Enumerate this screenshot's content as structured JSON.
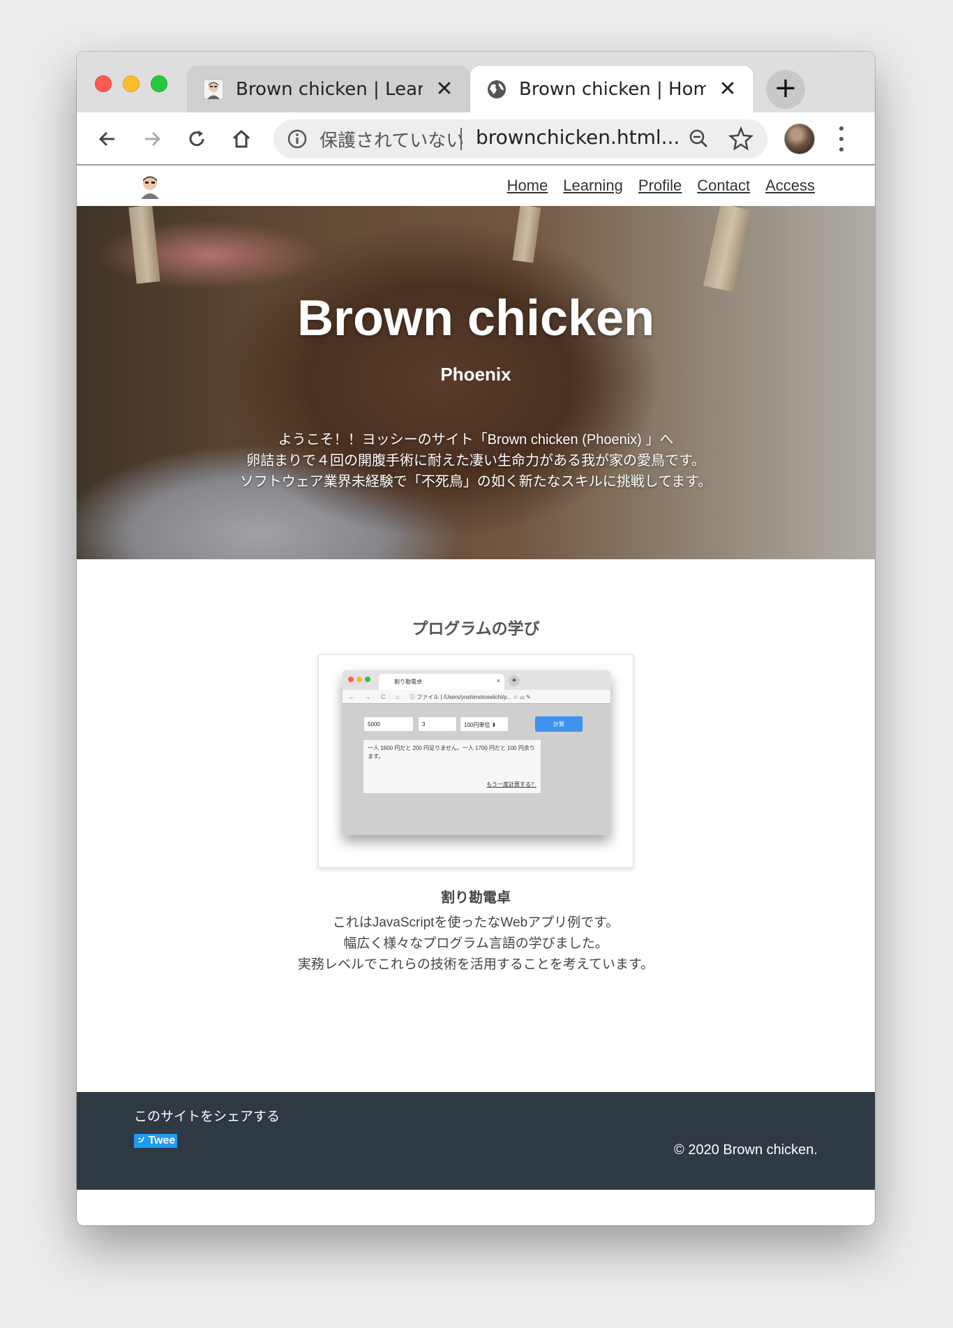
{
  "browser": {
    "tabs": [
      {
        "title": "Brown chicken | Learning",
        "close": "✕"
      },
      {
        "title": "Brown chicken | Home",
        "close": "✕"
      }
    ],
    "new_tab": "+",
    "omnibox": {
      "security_label": "保護されていない",
      "url": "brownchicken.html..."
    }
  },
  "nav": {
    "links": [
      "Home",
      "Learning",
      "Profile",
      "Contact",
      "Access"
    ]
  },
  "hero": {
    "title": "Brown chicken",
    "subtitle": "Phoenix",
    "lines": [
      "ようこそ！！ヨッシーのサイト「Brown chicken (Phoenix) 」へ",
      "卵詰まりで４回の開腹手術に耐えた凄い生命力がある我が家の愛鳥です。",
      "ソフトウェア業界未経験で「不死鳥」の如く新たなスキルに挑戦してます。"
    ]
  },
  "learning": {
    "section_title": "プログラムの学び",
    "thumbnail": {
      "tab_title": "割り勘電卓",
      "tab_close": "×",
      "new_tab": "+",
      "nav_arrows": "← → C ⌂",
      "address": "ⓘ ファイル | /Users/yoshimotoseiichi/p...   ☆   ⚏   ✎",
      "amount": "5000",
      "people": "3",
      "unit": "100円単位 ⬍",
      "calc_button": "計算",
      "result": "一人 1600 円だと 200 円足りません。一人 1700 円だと 100 円余ります。",
      "again_link": "もう一度計算する？"
    },
    "item_title": "割り勘電卓",
    "description": [
      "これはJavaScriptを使ったなWebアプリ例です。",
      "幅広く様々なプログラム言語の学びました。",
      "実務レベルでこれらの技術を活用することを考えています。"
    ]
  },
  "footer": {
    "share_label": "このサイトをシェアする",
    "tweet_button": "Twee",
    "copyright": "© 2020 Brown chicken."
  }
}
